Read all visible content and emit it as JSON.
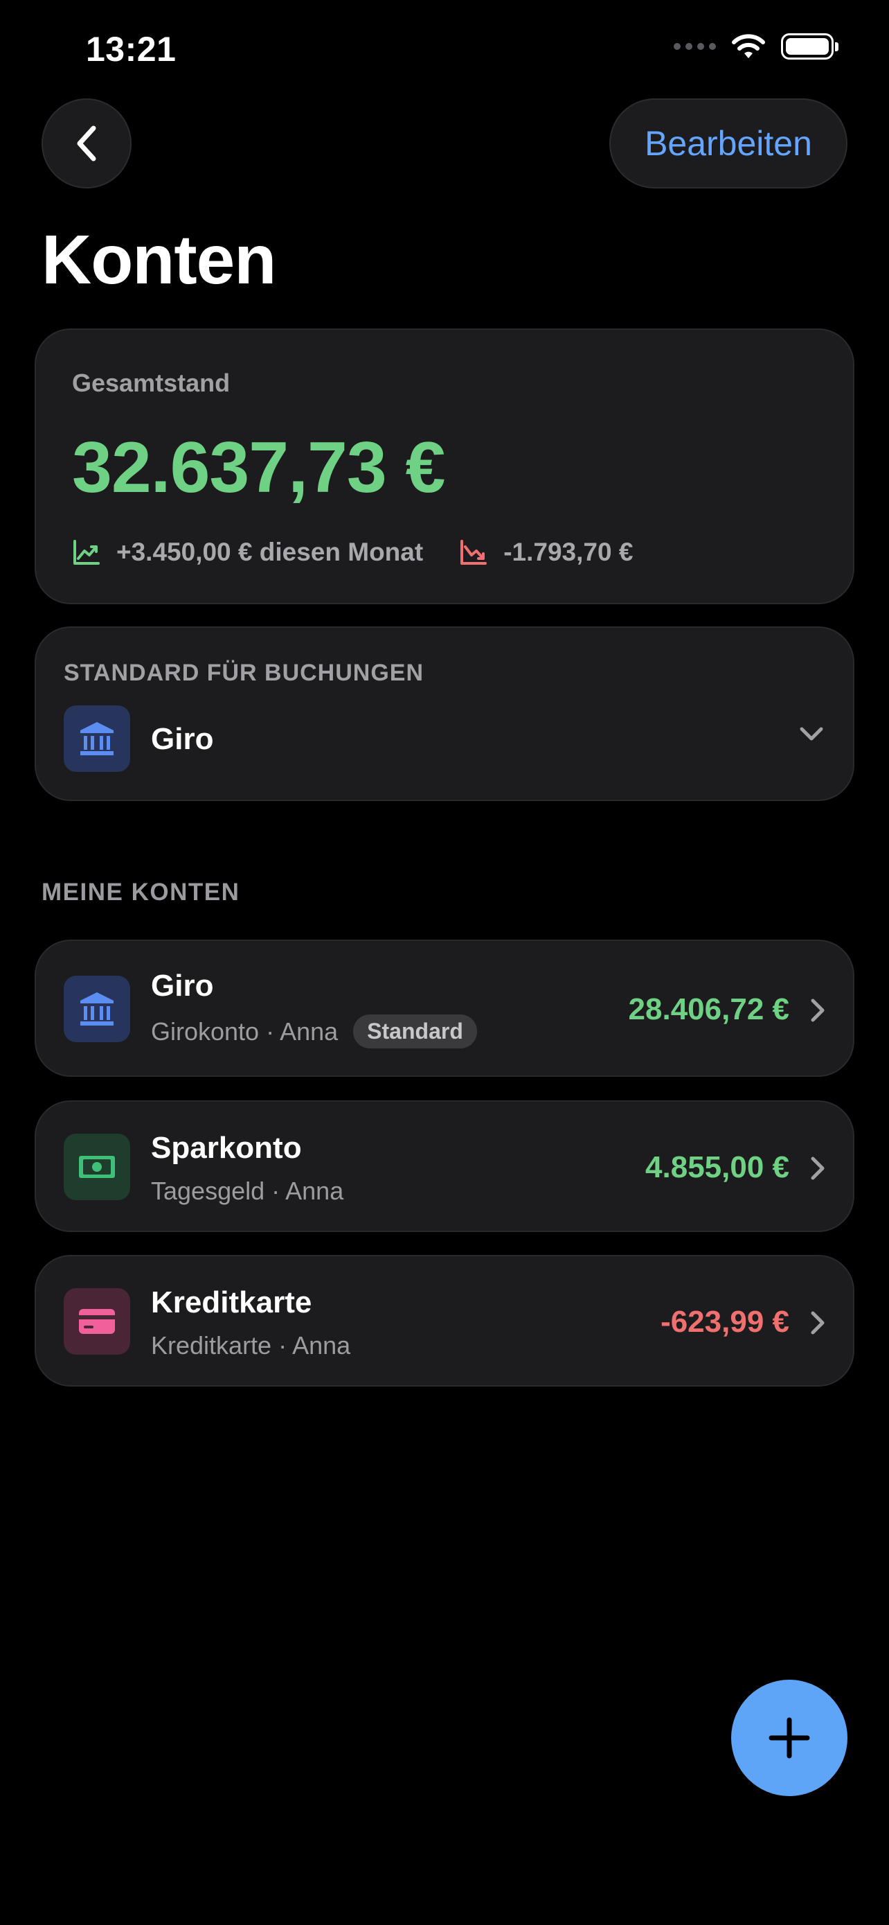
{
  "status_bar": {
    "time": "13:21"
  },
  "nav": {
    "edit_label": "Bearbeiten"
  },
  "page": {
    "title": "Konten"
  },
  "summary": {
    "label": "Gesamtstand",
    "total": "32.637,73 €",
    "income": "+3.450,00 € diesen Monat",
    "expenses": "-1.793,70 €"
  },
  "default_account": {
    "heading": "STANDARD FÜR BUCHUNGEN",
    "name": "Giro",
    "icon": "bank-icon"
  },
  "accounts_section": {
    "heading": "MEINE KONTEN"
  },
  "accounts": [
    {
      "name": "Giro",
      "subtitle": "Girokonto · Anna",
      "badge": "Standard",
      "amount": "28.406,72 €",
      "icon": "bank-icon",
      "icon_bg": "#27345c",
      "amount_color": "#6fd184"
    },
    {
      "name": "Sparkonto",
      "subtitle": "Tagesgeld · Anna",
      "amount": "4.855,00 €",
      "icon": "banknote-icon",
      "icon_bg": "#1f3d2c",
      "amount_color": "#6fd184"
    },
    {
      "name": "Kreditkarte",
      "subtitle": "Kreditkarte · Anna",
      "amount": "-623,99 €",
      "icon": "credit-card-icon",
      "icon_bg": "#4a2536",
      "amount_color": "#f07070"
    }
  ],
  "colors": {
    "accent": "#64a5ff",
    "positive": "#6fd184",
    "negative": "#f07070",
    "fab": "#5ea4f7"
  }
}
